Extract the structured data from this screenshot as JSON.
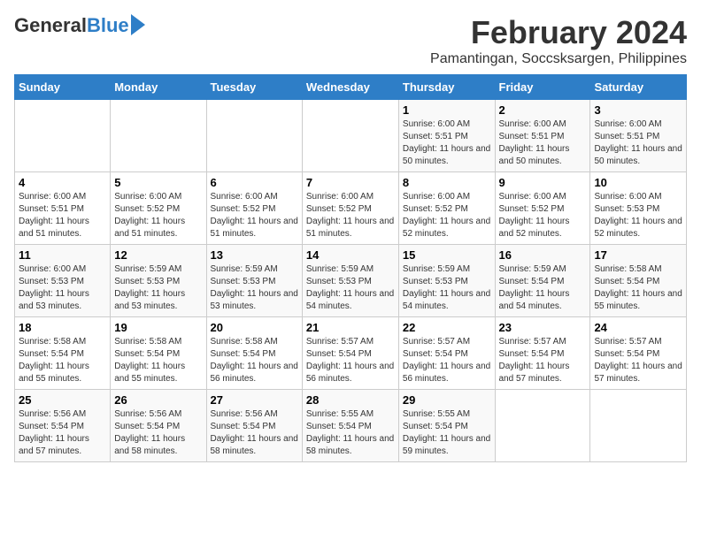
{
  "logo": {
    "general": "General",
    "blue": "Blue"
  },
  "title": "February 2024",
  "subtitle": "Pamantingan, Soccsksargen, Philippines",
  "days": [
    "Sunday",
    "Monday",
    "Tuesday",
    "Wednesday",
    "Thursday",
    "Friday",
    "Saturday"
  ],
  "weeks": [
    [
      {
        "num": "",
        "info": ""
      },
      {
        "num": "",
        "info": ""
      },
      {
        "num": "",
        "info": ""
      },
      {
        "num": "",
        "info": ""
      },
      {
        "num": "1",
        "info": "Sunrise: 6:00 AM\nSunset: 5:51 PM\nDaylight: 11 hours and 50 minutes."
      },
      {
        "num": "2",
        "info": "Sunrise: 6:00 AM\nSunset: 5:51 PM\nDaylight: 11 hours and 50 minutes."
      },
      {
        "num": "3",
        "info": "Sunrise: 6:00 AM\nSunset: 5:51 PM\nDaylight: 11 hours and 50 minutes."
      }
    ],
    [
      {
        "num": "4",
        "info": "Sunrise: 6:00 AM\nSunset: 5:51 PM\nDaylight: 11 hours and 51 minutes."
      },
      {
        "num": "5",
        "info": "Sunrise: 6:00 AM\nSunset: 5:52 PM\nDaylight: 11 hours and 51 minutes."
      },
      {
        "num": "6",
        "info": "Sunrise: 6:00 AM\nSunset: 5:52 PM\nDaylight: 11 hours and 51 minutes."
      },
      {
        "num": "7",
        "info": "Sunrise: 6:00 AM\nSunset: 5:52 PM\nDaylight: 11 hours and 51 minutes."
      },
      {
        "num": "8",
        "info": "Sunrise: 6:00 AM\nSunset: 5:52 PM\nDaylight: 11 hours and 52 minutes."
      },
      {
        "num": "9",
        "info": "Sunrise: 6:00 AM\nSunset: 5:52 PM\nDaylight: 11 hours and 52 minutes."
      },
      {
        "num": "10",
        "info": "Sunrise: 6:00 AM\nSunset: 5:53 PM\nDaylight: 11 hours and 52 minutes."
      }
    ],
    [
      {
        "num": "11",
        "info": "Sunrise: 6:00 AM\nSunset: 5:53 PM\nDaylight: 11 hours and 53 minutes."
      },
      {
        "num": "12",
        "info": "Sunrise: 5:59 AM\nSunset: 5:53 PM\nDaylight: 11 hours and 53 minutes."
      },
      {
        "num": "13",
        "info": "Sunrise: 5:59 AM\nSunset: 5:53 PM\nDaylight: 11 hours and 53 minutes."
      },
      {
        "num": "14",
        "info": "Sunrise: 5:59 AM\nSunset: 5:53 PM\nDaylight: 11 hours and 54 minutes."
      },
      {
        "num": "15",
        "info": "Sunrise: 5:59 AM\nSunset: 5:53 PM\nDaylight: 11 hours and 54 minutes."
      },
      {
        "num": "16",
        "info": "Sunrise: 5:59 AM\nSunset: 5:54 PM\nDaylight: 11 hours and 54 minutes."
      },
      {
        "num": "17",
        "info": "Sunrise: 5:58 AM\nSunset: 5:54 PM\nDaylight: 11 hours and 55 minutes."
      }
    ],
    [
      {
        "num": "18",
        "info": "Sunrise: 5:58 AM\nSunset: 5:54 PM\nDaylight: 11 hours and 55 minutes."
      },
      {
        "num": "19",
        "info": "Sunrise: 5:58 AM\nSunset: 5:54 PM\nDaylight: 11 hours and 55 minutes."
      },
      {
        "num": "20",
        "info": "Sunrise: 5:58 AM\nSunset: 5:54 PM\nDaylight: 11 hours and 56 minutes."
      },
      {
        "num": "21",
        "info": "Sunrise: 5:57 AM\nSunset: 5:54 PM\nDaylight: 11 hours and 56 minutes."
      },
      {
        "num": "22",
        "info": "Sunrise: 5:57 AM\nSunset: 5:54 PM\nDaylight: 11 hours and 56 minutes."
      },
      {
        "num": "23",
        "info": "Sunrise: 5:57 AM\nSunset: 5:54 PM\nDaylight: 11 hours and 57 minutes."
      },
      {
        "num": "24",
        "info": "Sunrise: 5:57 AM\nSunset: 5:54 PM\nDaylight: 11 hours and 57 minutes."
      }
    ],
    [
      {
        "num": "25",
        "info": "Sunrise: 5:56 AM\nSunset: 5:54 PM\nDaylight: 11 hours and 57 minutes."
      },
      {
        "num": "26",
        "info": "Sunrise: 5:56 AM\nSunset: 5:54 PM\nDaylight: 11 hours and 58 minutes."
      },
      {
        "num": "27",
        "info": "Sunrise: 5:56 AM\nSunset: 5:54 PM\nDaylight: 11 hours and 58 minutes."
      },
      {
        "num": "28",
        "info": "Sunrise: 5:55 AM\nSunset: 5:54 PM\nDaylight: 11 hours and 58 minutes."
      },
      {
        "num": "29",
        "info": "Sunrise: 5:55 AM\nSunset: 5:54 PM\nDaylight: 11 hours and 59 minutes."
      },
      {
        "num": "",
        "info": ""
      },
      {
        "num": "",
        "info": ""
      }
    ]
  ]
}
